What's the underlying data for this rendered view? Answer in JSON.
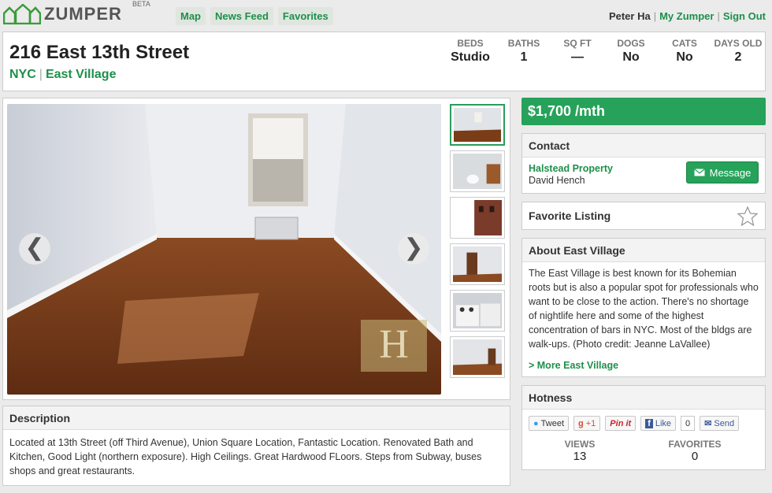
{
  "app": {
    "logo_text": "ZUMPER",
    "logo_badge": "BETA"
  },
  "nav": {
    "items": [
      "Map",
      "News Feed",
      "Favorites"
    ]
  },
  "user": {
    "name": "Peter Ha",
    "my_link": "My Zumper",
    "sign_out": "Sign Out",
    "separator": "|"
  },
  "listing": {
    "address": "216 East 13th Street",
    "city": "NYC",
    "neighborhood": "East Village",
    "stats": [
      {
        "label": "BEDS",
        "value": "Studio"
      },
      {
        "label": "BATHS",
        "value": "1"
      },
      {
        "label": "SQ FT",
        "value": "—"
      },
      {
        "label": "DOGS",
        "value": "No"
      },
      {
        "label": "CATS",
        "value": "No"
      },
      {
        "label": "DAYS OLD",
        "value": "2"
      }
    ]
  },
  "gallery": {
    "prev_icon": "chevron-left-icon",
    "next_icon": "chevron-right-icon",
    "prev_glyph": "❮",
    "next_glyph": "❯",
    "thumbnail_count": 6
  },
  "description": {
    "title": "Description",
    "text": "Located at 13th Street (off Third Avenue), Union Square Location, Fantastic Location. Renovated Bath and Kitchen, Good Light (northern exposure). High Ceilings. Great Hardwood FLoors. Steps from Subway, buses shops and great restaurants."
  },
  "price": "$1,700 /mth",
  "contact": {
    "title": "Contact",
    "agency": "Halstead Property",
    "agent": "David Hench",
    "message_button": "Message"
  },
  "favorite": {
    "title": "Favorite Listing"
  },
  "about": {
    "title": "About East Village",
    "text": "The East Village is best known for its Bohemian roots but is also a popular spot for professionals who want to be close to the action. There's no shortage of nightlife here and some of the highest concentration of bars in NYC. Most of the bldgs are walk-ups. (Photo credit: Jeanne LaVallee)",
    "more_link": "> More East Village"
  },
  "hotness": {
    "title": "Hotness",
    "tweet": "Tweet",
    "gplus": "+1",
    "pinit": "Pin it",
    "like": "Like",
    "like_count": "0",
    "send": "Send",
    "views_label": "VIEWS",
    "views": "13",
    "favorites_label": "FAVORITES",
    "favorites": "0"
  },
  "colors": {
    "brand_green": "#26a25a",
    "link_green": "#1e8f4a"
  }
}
